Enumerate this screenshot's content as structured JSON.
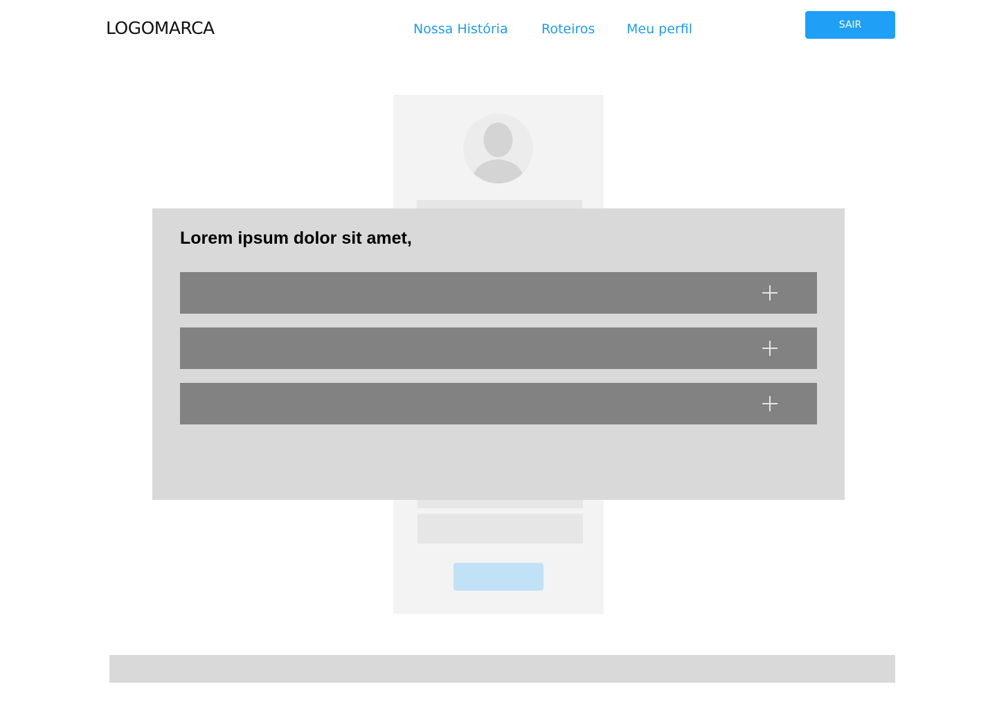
{
  "header": {
    "logo": "LOGOMARCA",
    "nav": [
      {
        "label": "Nossa História"
      },
      {
        "label": "Roteiros"
      },
      {
        "label": "Meu perfil"
      }
    ],
    "logout_label": "SAIR"
  },
  "modal": {
    "title": "Lorem ipsum dolor sit amet,",
    "rows": [
      {
        "icon": "plus-icon"
      },
      {
        "icon": "plus-icon"
      },
      {
        "icon": "plus-icon"
      }
    ]
  },
  "colors": {
    "accent": "#1f9ff5",
    "link": "#1f9bf0",
    "modal_bg": "#d9d9d9",
    "row_bg": "#828282"
  }
}
